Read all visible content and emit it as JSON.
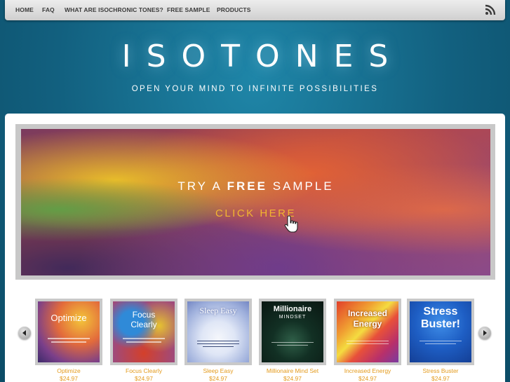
{
  "nav": {
    "items": [
      "HOME",
      "FAQ",
      "WHAT ARE ISOCHRONIC TONES?",
      "FREE SAMPLE",
      "PRODUCTS"
    ],
    "rss_icon": "rss-icon"
  },
  "header": {
    "logo": "ISOTONES",
    "tagline": "OPEN YOUR MIND TO INFINITE POSSIBILITIES"
  },
  "banner": {
    "try_prefix": "TRY A",
    "try_bold": "FREE",
    "try_suffix": "SAMPLE",
    "cta": "CLICK HERE",
    "cursor_icon": "hand-pointer-icon"
  },
  "carousel": {
    "prev_icon": "arrow-left-icon",
    "next_icon": "arrow-right-icon",
    "products": [
      {
        "cover_title": "Optimize",
        "name": "Optimize",
        "price": "$24.97"
      },
      {
        "cover_title": "Focus Clearly",
        "name": "Focus Clearly",
        "price": "$24.97"
      },
      {
        "cover_title": "Sleep Easy",
        "name": "Sleep Easy",
        "price": "$24.97"
      },
      {
        "cover_title": "Millionaire",
        "cover_subtitle": "MINDSET",
        "name": "Millionaire Mind Set",
        "price": "$24.97"
      },
      {
        "cover_title": "Increased Energy",
        "name": "Increased Energy",
        "price": "$24.97"
      },
      {
        "cover_title": "Stress Buster!",
        "name": "Stress Buster",
        "price": "$24.97"
      }
    ]
  },
  "colors": {
    "background": "#12607f",
    "accent_orange": "#e39a1c",
    "cta_gold": "#f2b531"
  }
}
